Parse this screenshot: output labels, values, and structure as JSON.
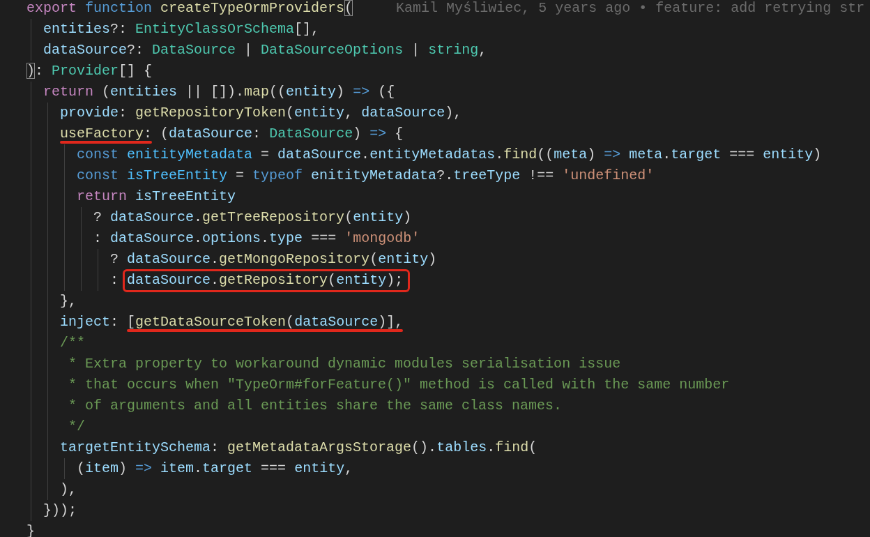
{
  "editor": {
    "lines": [
      {
        "segments": [
          {
            "kind": "keyword",
            "text": "export "
          },
          {
            "kind": "storage",
            "text": "function "
          },
          {
            "kind": "function",
            "text": "createTypeOrmProviders"
          },
          {
            "kind": "plain",
            "text": "(",
            "bracket_match": true
          }
        ],
        "blame": "Kamil Myśliwiec, 5 years ago • feature: add retrying str"
      },
      {
        "segments": [
          {
            "kind": "variable",
            "text": "  entities"
          },
          {
            "kind": "plain",
            "text": "?: "
          },
          {
            "kind": "type",
            "text": "EntityClassOrSchema"
          },
          {
            "kind": "plain",
            "text": "[],"
          }
        ]
      },
      {
        "segments": [
          {
            "kind": "variable",
            "text": "  dataSource"
          },
          {
            "kind": "plain",
            "text": "?: "
          },
          {
            "kind": "type",
            "text": "DataSource"
          },
          {
            "kind": "plain",
            "text": " | "
          },
          {
            "kind": "type",
            "text": "DataSourceOptions"
          },
          {
            "kind": "plain",
            "text": " | "
          },
          {
            "kind": "type",
            "text": "string"
          },
          {
            "kind": "plain",
            "text": ","
          }
        ]
      },
      {
        "segments": [
          {
            "kind": "plain",
            "text": ")",
            "bracket_match": true
          },
          {
            "kind": "plain",
            "text": ": "
          },
          {
            "kind": "type",
            "text": "Provider"
          },
          {
            "kind": "plain",
            "text": "[] {"
          }
        ]
      },
      {
        "segments": [
          {
            "kind": "keyword",
            "text": "  return"
          },
          {
            "kind": "plain",
            "text": " ("
          },
          {
            "kind": "variable",
            "text": "entities"
          },
          {
            "kind": "plain",
            "text": " || [])."
          },
          {
            "kind": "function",
            "text": "map"
          },
          {
            "kind": "plain",
            "text": "(("
          },
          {
            "kind": "variable",
            "text": "entity"
          },
          {
            "kind": "plain",
            "text": ") "
          },
          {
            "kind": "storage",
            "text": "=>"
          },
          {
            "kind": "plain",
            "text": " ({"
          }
        ]
      },
      {
        "segments": [
          {
            "kind": "variable",
            "text": "    provide"
          },
          {
            "kind": "plain",
            "text": ": "
          },
          {
            "kind": "function",
            "text": "getRepositoryToken"
          },
          {
            "kind": "plain",
            "text": "("
          },
          {
            "kind": "variable",
            "text": "entity"
          },
          {
            "kind": "plain",
            "text": ", "
          },
          {
            "kind": "variable",
            "text": "dataSource"
          },
          {
            "kind": "plain",
            "text": "),"
          }
        ]
      },
      {
        "segments": [
          {
            "kind": "underline_annotation",
            "segments": [
              {
                "kind": "function",
                "text": "    useFactory"
              },
              {
                "kind": "plain",
                "text": ":"
              }
            ]
          },
          {
            "kind": "plain",
            "text": " ("
          },
          {
            "kind": "variable",
            "text": "dataSource"
          },
          {
            "kind": "plain",
            "text": ": "
          },
          {
            "kind": "type",
            "text": "DataSource"
          },
          {
            "kind": "plain",
            "text": ") "
          },
          {
            "kind": "storage",
            "text": "=>"
          },
          {
            "kind": "plain",
            "text": " {"
          }
        ]
      },
      {
        "segments": [
          {
            "kind": "storage",
            "text": "      const "
          },
          {
            "kind": "constant",
            "text": "enitityMetadata"
          },
          {
            "kind": "plain",
            "text": " = "
          },
          {
            "kind": "variable",
            "text": "dataSource"
          },
          {
            "kind": "plain",
            "text": "."
          },
          {
            "kind": "variable",
            "text": "entityMetadatas"
          },
          {
            "kind": "plain",
            "text": "."
          },
          {
            "kind": "function",
            "text": "find"
          },
          {
            "kind": "plain",
            "text": "(("
          },
          {
            "kind": "variable",
            "text": "meta"
          },
          {
            "kind": "plain",
            "text": ") "
          },
          {
            "kind": "storage",
            "text": "=> "
          },
          {
            "kind": "variable",
            "text": "meta"
          },
          {
            "kind": "plain",
            "text": "."
          },
          {
            "kind": "variable",
            "text": "target"
          },
          {
            "kind": "plain",
            "text": " === "
          },
          {
            "kind": "variable",
            "text": "entity"
          },
          {
            "kind": "plain",
            "text": ")"
          }
        ]
      },
      {
        "segments": [
          {
            "kind": "storage",
            "text": "      const "
          },
          {
            "kind": "constant",
            "text": "isTreeEntity"
          },
          {
            "kind": "plain",
            "text": " = "
          },
          {
            "kind": "storage",
            "text": "typeof "
          },
          {
            "kind": "variable",
            "text": "enitityMetadata"
          },
          {
            "kind": "plain",
            "text": "?."
          },
          {
            "kind": "variable",
            "text": "treeType"
          },
          {
            "kind": "plain",
            "text": " !== "
          },
          {
            "kind": "string",
            "text": "'undefined'"
          }
        ]
      },
      {
        "segments": [
          {
            "kind": "keyword",
            "text": "      return "
          },
          {
            "kind": "variable",
            "text": "isTreeEntity"
          }
        ]
      },
      {
        "segments": [
          {
            "kind": "plain",
            "text": "        ? "
          },
          {
            "kind": "variable",
            "text": "dataSource"
          },
          {
            "kind": "plain",
            "text": "."
          },
          {
            "kind": "function",
            "text": "getTreeRepository"
          },
          {
            "kind": "plain",
            "text": "("
          },
          {
            "kind": "variable",
            "text": "entity"
          },
          {
            "kind": "plain",
            "text": ")"
          }
        ]
      },
      {
        "segments": [
          {
            "kind": "plain",
            "text": "        : "
          },
          {
            "kind": "variable",
            "text": "dataSource"
          },
          {
            "kind": "plain",
            "text": "."
          },
          {
            "kind": "variable",
            "text": "options"
          },
          {
            "kind": "plain",
            "text": "."
          },
          {
            "kind": "variable",
            "text": "type"
          },
          {
            "kind": "plain",
            "text": " === "
          },
          {
            "kind": "string",
            "text": "'mongodb'"
          }
        ]
      },
      {
        "segments": [
          {
            "kind": "plain",
            "text": "          ? "
          },
          {
            "kind": "variable",
            "text": "dataSource"
          },
          {
            "kind": "plain",
            "text": "."
          },
          {
            "kind": "function",
            "text": "getMongoRepository"
          },
          {
            "kind": "plain",
            "text": "("
          },
          {
            "kind": "variable",
            "text": "entity"
          },
          {
            "kind": "plain",
            "text": ")"
          }
        ]
      },
      {
        "segments": [
          {
            "kind": "plain",
            "text": "          : "
          },
          {
            "kind": "box_annotation",
            "segments": [
              {
                "kind": "variable",
                "text": "dataSource"
              },
              {
                "kind": "plain",
                "text": "."
              },
              {
                "kind": "function",
                "text": "getRepository"
              },
              {
                "kind": "plain",
                "text": "("
              },
              {
                "kind": "variable",
                "text": "entity"
              },
              {
                "kind": "plain",
                "text": ");"
              }
            ]
          }
        ]
      },
      {
        "segments": [
          {
            "kind": "plain",
            "text": "    },"
          }
        ]
      },
      {
        "segments": [
          {
            "kind": "variable",
            "text": "    inject"
          },
          {
            "kind": "plain",
            "text": ": "
          },
          {
            "kind": "underline_annotation",
            "segments": [
              {
                "kind": "plain",
                "text": "["
              },
              {
                "kind": "function",
                "text": "getDataSourceToken"
              },
              {
                "kind": "plain",
                "text": "("
              },
              {
                "kind": "variable",
                "text": "dataSource"
              },
              {
                "kind": "plain",
                "text": ")],"
              }
            ]
          }
        ]
      },
      {
        "segments": [
          {
            "kind": "comment",
            "text": "    /**"
          }
        ]
      },
      {
        "segments": [
          {
            "kind": "comment",
            "text": "     * Extra property to workaround dynamic modules serialisation issue"
          }
        ]
      },
      {
        "segments": [
          {
            "kind": "comment",
            "text": "     * that occurs when \"TypeOrm#forFeature()\" method is called with the same number"
          }
        ]
      },
      {
        "segments": [
          {
            "kind": "comment",
            "text": "     * of arguments and all entities share the same class names."
          }
        ]
      },
      {
        "segments": [
          {
            "kind": "comment",
            "text": "     */"
          }
        ]
      },
      {
        "segments": [
          {
            "kind": "variable",
            "text": "    targetEntitySchema"
          },
          {
            "kind": "plain",
            "text": ": "
          },
          {
            "kind": "function",
            "text": "getMetadataArgsStorage"
          },
          {
            "kind": "plain",
            "text": "()."
          },
          {
            "kind": "variable",
            "text": "tables"
          },
          {
            "kind": "plain",
            "text": "."
          },
          {
            "kind": "function",
            "text": "find"
          },
          {
            "kind": "plain",
            "text": "("
          }
        ]
      },
      {
        "segments": [
          {
            "kind": "plain",
            "text": "      ("
          },
          {
            "kind": "variable",
            "text": "item"
          },
          {
            "kind": "plain",
            "text": ") "
          },
          {
            "kind": "storage",
            "text": "=> "
          },
          {
            "kind": "variable",
            "text": "item"
          },
          {
            "kind": "plain",
            "text": "."
          },
          {
            "kind": "variable",
            "text": "target"
          },
          {
            "kind": "plain",
            "text": " === "
          },
          {
            "kind": "variable",
            "text": "entity"
          },
          {
            "kind": "plain",
            "text": ","
          }
        ]
      },
      {
        "segments": [
          {
            "kind": "plain",
            "text": "    ),"
          }
        ]
      },
      {
        "segments": [
          {
            "kind": "plain",
            "text": "  }));"
          }
        ]
      },
      {
        "segments": [
          {
            "kind": "plain",
            "text": "}"
          }
        ]
      }
    ]
  }
}
